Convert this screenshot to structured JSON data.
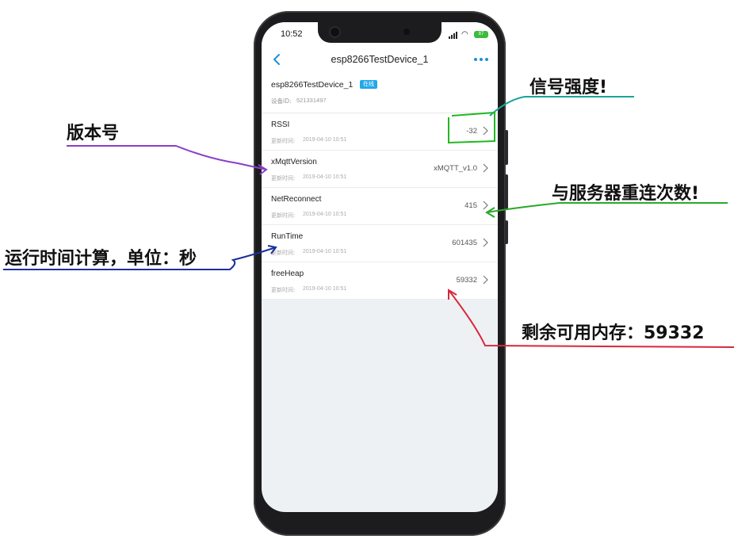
{
  "status_bar": {
    "time": "10:52",
    "battery": "87"
  },
  "nav": {
    "title": "esp8266TestDevice_1"
  },
  "device": {
    "name": "esp8266TestDevice_1",
    "status_badge": "在线",
    "id_label": "设备ID:",
    "id_value": "521331497"
  },
  "properties": [
    {
      "name": "RSSI",
      "time_label": "更新时间:",
      "time": "2019-04-10 10:51",
      "value": "-32"
    },
    {
      "name": "xMqttVersion",
      "time_label": "更新时间:",
      "time": "2019-04-10 10:51",
      "value": "xMQTT_v1.0"
    },
    {
      "name": "NetReconnect",
      "time_label": "更新时间:",
      "time": "2019-04-10 10:51",
      "value": "415"
    },
    {
      "name": "RunTime",
      "time_label": "更新时间:",
      "time": "2019-04-10 10:51",
      "value": "601435"
    },
    {
      "name": "freeHeap",
      "time_label": "更新时间:",
      "time": "2019-04-10 10:51",
      "value": "59332"
    }
  ],
  "annotations": {
    "version": "版本号",
    "signal": "信号强度!",
    "reconnect": "与服务器重连次数!",
    "runtime": "运行时间计算，单位：秒",
    "free_heap": "剩余可用内存：59332"
  },
  "colors": {
    "accent": "#1e90d9",
    "online_badge": "#22a8e8",
    "anno_version": "#8a3fc6",
    "anno_signal": "#1aa59a",
    "anno_reconnect": "#2aa82a",
    "anno_runtime": "#1a2f9e",
    "anno_heap": "#d8283a",
    "rssi_box": "#22b822"
  },
  "icons": [
    "back-arrow-icon",
    "more-dots-icon",
    "chevron-right-icon",
    "signal-icon",
    "wifi-icon",
    "battery-icon"
  ]
}
